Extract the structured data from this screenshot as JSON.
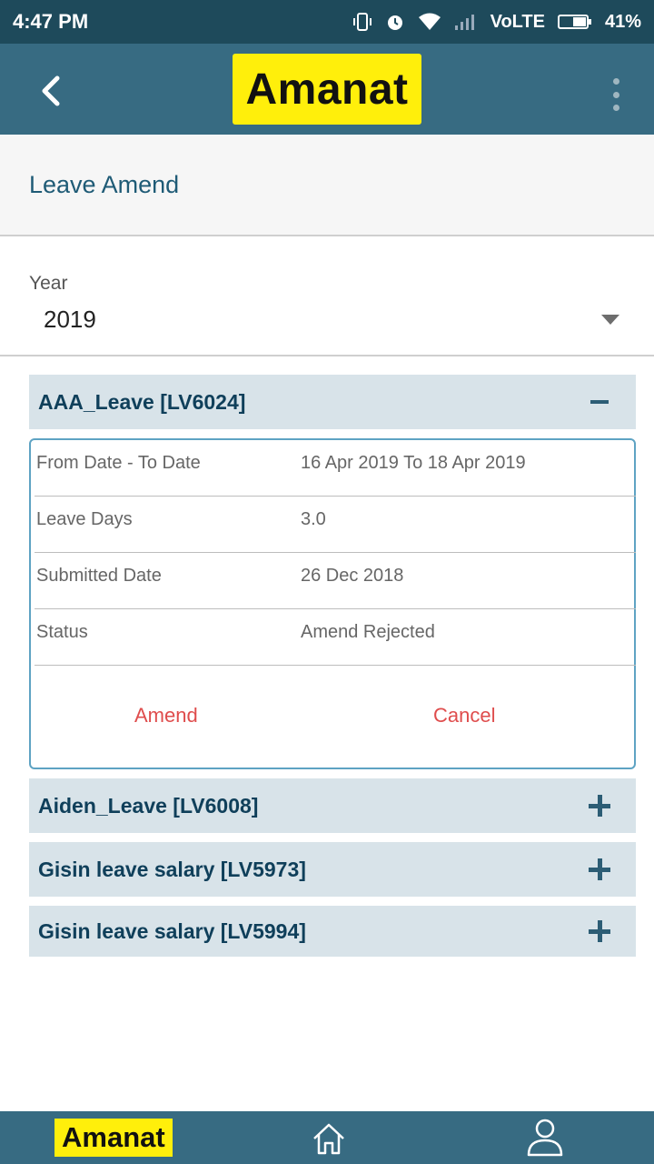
{
  "status_bar": {
    "time": "4:47 PM",
    "network": "VoLTE",
    "battery": "41%",
    "icons": [
      "vibrate-icon",
      "alarm-icon",
      "wifi-icon",
      "signal-icon",
      "battery-icon"
    ]
  },
  "app_bar": {
    "logo_text": "Amanat",
    "back_icon": "back-arrow-icon",
    "menu_icon": "more-vert-icon"
  },
  "page": {
    "title": "Leave Amend"
  },
  "year_selector": {
    "label": "Year",
    "value": "2019"
  },
  "leaves": [
    {
      "title": "AAA_Leave [LV6024]",
      "expanded": true,
      "details": [
        {
          "label": "From Date - To Date",
          "value": "16 Apr 2019 To 18 Apr 2019"
        },
        {
          "label": "Leave Days",
          "value": "3.0"
        },
        {
          "label": "Submitted Date",
          "value": "26 Dec 2018"
        },
        {
          "label": "Status",
          "value": "Amend Rejected"
        }
      ],
      "actions": {
        "amend": "Amend",
        "cancel": "Cancel"
      }
    },
    {
      "title": "Aiden_Leave [LV6008]",
      "expanded": false
    },
    {
      "title": "Gisin leave salary [LV5973]",
      "expanded": false
    },
    {
      "title": "Gisin leave salary [LV5994]",
      "expanded": false
    }
  ],
  "bottom_nav": {
    "logo_text": "Amanat",
    "items": [
      "home-icon",
      "profile-icon"
    ]
  },
  "colors": {
    "status_bar": "#1e4a5b",
    "app_bar": "#376b82",
    "logo_bg": "#ffef0b",
    "accordion_bg": "#d8e3e9",
    "accordion_text": "#0f3f5a",
    "action_text": "#df4d4d",
    "card_border": "#5ea3c3"
  }
}
